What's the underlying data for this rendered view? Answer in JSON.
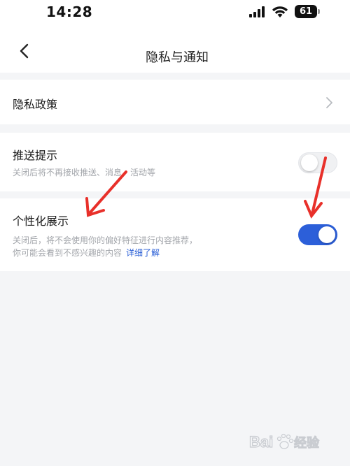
{
  "status_bar": {
    "time": "14:28",
    "battery": "61",
    "icons": [
      "signal-icon",
      "wifi-icon",
      "battery-icon"
    ]
  },
  "nav": {
    "title": "隐私与通知",
    "back_icon": "chevron-left-icon"
  },
  "items": [
    {
      "title": "隐私政策",
      "accessory": "chevron-right-icon"
    },
    {
      "title": "推送提示",
      "description": "关闭后将不再接收推送、消息、活动等",
      "toggle": false
    },
    {
      "title": "个性化展示",
      "description_line1": "关闭后，将不会使用你的偏好特征进行内容推荐，",
      "description_line2": "你可能会看到不感兴趣的内容",
      "link": "详细了解",
      "toggle": true
    }
  ],
  "colors": {
    "accent": "#2c5fd9",
    "link": "#2a5fd6",
    "background": "#f4f5f7",
    "annotation_arrow": "#e8302a"
  },
  "watermark": {
    "text": "Bai 经验",
    "icon": "baidu-paw-icon"
  }
}
